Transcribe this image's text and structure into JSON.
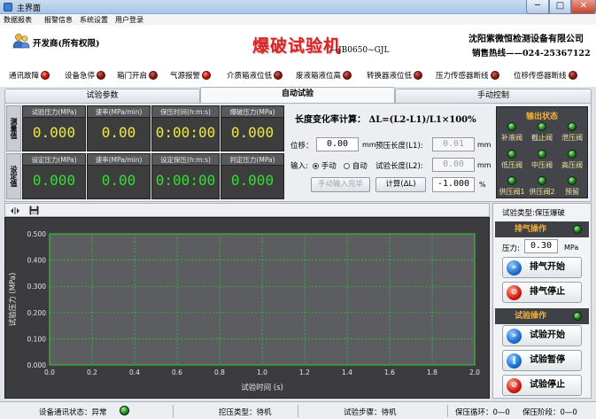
{
  "window": {
    "title": "主界面",
    "min_glyph": "─",
    "max_glyph": "□",
    "close_glyph": "✕"
  },
  "menu": [
    "数据报表",
    "报警信息",
    "系统设置",
    "用户登录"
  ],
  "header": {
    "user": "开发商(所有权限)",
    "title": "爆破试验机",
    "model": "—JB0650~GJL",
    "company": "沈阳紫微恒检测设备有限公司",
    "hotline": "销售热线——024-25367122"
  },
  "indicators": [
    {
      "label": "通讯故障",
      "state": "red"
    },
    {
      "label": "设备急停",
      "state": "off"
    },
    {
      "label": "箱门开启",
      "state": "off"
    },
    {
      "label": "气源报警",
      "state": "red"
    },
    {
      "label": "介质箱液位低",
      "state": "off"
    },
    {
      "label": "废液箱液位高",
      "state": "off"
    },
    {
      "label": "转换器液位低",
      "state": "off"
    },
    {
      "label": "压力传感器断线",
      "state": "off"
    },
    {
      "label": "位移传感器断线",
      "state": "off"
    }
  ],
  "tabs": [
    "试验参数",
    "自动试验",
    "手动控制"
  ],
  "active_tab": 1,
  "realtime": {
    "side_label": "测量值",
    "items": [
      {
        "caption": "试验压力(MPa)",
        "value": "0.000"
      },
      {
        "caption": "速率(MPa/min)",
        "value": "0.00"
      },
      {
        "caption": "保压时间(h:m:s)",
        "value": "0:00:00"
      },
      {
        "caption": "爆破压力(MPa)",
        "value": "0.000"
      }
    ]
  },
  "setpoints": {
    "side_label": "设定值",
    "items": [
      {
        "caption": "设定压力(MPa)",
        "value": "0.000"
      },
      {
        "caption": "速率(MPa/min)",
        "value": "0.00"
      },
      {
        "caption": "设定保压(h:m:s)",
        "value": "0:00:00"
      },
      {
        "caption": "判定压力(MPa)",
        "value": "0.000"
      }
    ]
  },
  "elongation": {
    "title": "长度变化率计算：  ΔL=(L2-L1)/L1×100%",
    "displacement_label": "位移：",
    "displacement_value": "0.00",
    "displacement_unit": "mm",
    "prepress_label": "预压长度(L1):",
    "prepress_value": "0.01",
    "prepress_unit": "mm",
    "input_label": "输入:",
    "manual_label": "手动",
    "auto_label": "自动",
    "test_length_label": "试验长度(L2):",
    "test_length_value": "0.00",
    "test_length_unit": "mm",
    "manual_done_button": "手动输入完毕",
    "calc_button": "计算(ΔL)",
    "result_value": "-1.000",
    "result_unit": "%"
  },
  "outputs": {
    "title": "输出状态",
    "items": [
      "补液阀",
      "截止阀",
      "泄压阀",
      "低压阀",
      "中压阀",
      "高压阀",
      "供压阀1",
      "供压阀2",
      "预留"
    ]
  },
  "chart_data": {
    "type": "line",
    "title": "",
    "xlabel": "试验时间 (s)",
    "ylabel": "试验压力 (MPa)",
    "xlim": [
      0,
      2.0
    ],
    "ylim": [
      0,
      0.5
    ],
    "x_ticks": [
      "0.0",
      "0.2",
      "0.4",
      "0.6",
      "0.8",
      "1.0",
      "1.2",
      "1.4",
      "1.6",
      "1.8",
      "2.0"
    ],
    "y_ticks": [
      "0.000",
      "0.100",
      "0.200",
      "0.300",
      "0.400",
      "0.500"
    ],
    "grid": true,
    "series": []
  },
  "control": {
    "test_type": "试验类型:保压爆破",
    "exhaust_head": "排气操作",
    "pressure_label": "压力:",
    "pressure_value": "0.30",
    "pressure_unit": "MPa",
    "exhaust_start": "排气开始",
    "exhaust_stop": "排气停止",
    "test_head": "试验操作",
    "test_start": "试验开始",
    "test_pause": "试验暂停",
    "test_stop": "试验停止"
  },
  "status": {
    "comm_label": "设备通讯状态：异常",
    "type_label": "挖压类型：待机",
    "step_label": "试验步骤：待机",
    "cycle_label": "保压循环：0—0",
    "stage_label": "保压阶段：0—0"
  }
}
